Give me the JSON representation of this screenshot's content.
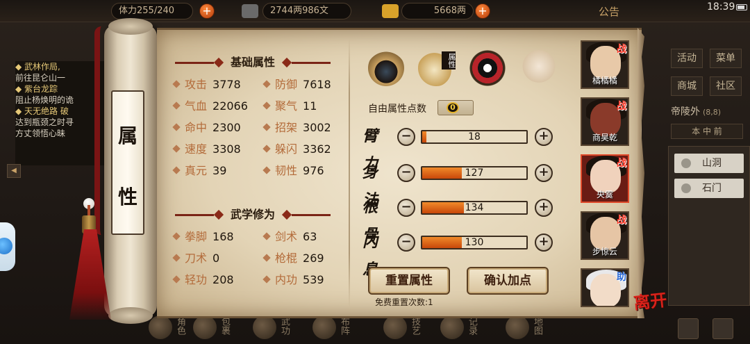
{
  "status": {
    "time": "18:39",
    "notice_label": "公告"
  },
  "resources": {
    "stamina": "体力255/240",
    "money": "2744两986文",
    "gold": "5668两"
  },
  "quests": [
    {
      "title": "◆ 武林作局,",
      "desc": "前往昆仑山一"
    },
    {
      "title": "◆ 紫台龙踪",
      "desc": "阻止杨焕明的诡"
    },
    {
      "title": "◆ 天无绝路 破",
      "desc": "达到瓶颈之时寻"
    },
    {
      "title": "",
      "desc": "方丈领悟心昧"
    }
  ],
  "scroll_title": [
    "属",
    "性"
  ],
  "basic_attrs": {
    "title": "基础属性",
    "items": [
      {
        "label": "攻击",
        "value": "3778"
      },
      {
        "label": "防御",
        "value": "7618"
      },
      {
        "label": "气血",
        "value": "22066"
      },
      {
        "label": "聚气",
        "value": "11"
      },
      {
        "label": "命中",
        "value": "2300"
      },
      {
        "label": "招架",
        "value": "3002"
      },
      {
        "label": "速度",
        "value": "3308"
      },
      {
        "label": "躲闪",
        "value": "3362"
      },
      {
        "label": "真元",
        "value": "39"
      },
      {
        "label": "韧性",
        "value": "976"
      }
    ]
  },
  "martial_attrs": {
    "title": "武学修为",
    "items": [
      {
        "label": "拳脚",
        "value": "168"
      },
      {
        "label": "剑术",
        "value": "63"
      },
      {
        "label": "刀术",
        "value": "0"
      },
      {
        "label": "枪棍",
        "value": "269"
      },
      {
        "label": "轻功",
        "value": "208"
      },
      {
        "label": "内功",
        "value": "539"
      }
    ]
  },
  "category_icons": [
    "hat-icon",
    "attribute-book-icon",
    "bagua-icon",
    "meridian-figure-icon"
  ],
  "category_badge": "属性",
  "free_points": {
    "label": "自由属性点数",
    "value": "0"
  },
  "allocations": [
    {
      "name": "臂力",
      "value": 18,
      "fill": 0.04
    },
    {
      "name": "身法",
      "value": 127,
      "fill": 0.38
    },
    {
      "name": "根骨",
      "value": 134,
      "fill": 0.4
    },
    {
      "name": "内息",
      "value": 130,
      "fill": 0.38
    }
  ],
  "buttons": {
    "reset": "重置属性",
    "confirm": "确认加点"
  },
  "reset_note": "免费重置次数:1",
  "heroes": [
    {
      "name": "橘橘橘",
      "tag": "战",
      "active": false,
      "skin": "#e8c9a8"
    },
    {
      "name": "商昊乾",
      "tag": "战",
      "active": false,
      "skin": "#8a3a2a"
    },
    {
      "name": "央霙",
      "tag": "战",
      "active": true,
      "skin": "#f0d2bc"
    },
    {
      "name": "步惊云",
      "tag": "战",
      "active": false,
      "skin": "#e6c5a5"
    },
    {
      "name": "",
      "tag": "助",
      "active": false,
      "skin": "#f2dcc8"
    }
  ],
  "leave_label": "离开",
  "right_menu": [
    "活动",
    "菜单",
    "商城",
    "社区"
  ],
  "location": {
    "name": "帝陵外",
    "coords": "(8,8)"
  },
  "location_tabs": "本 中 前",
  "map_items": [
    "山洞",
    "石门"
  ],
  "bottom_menu": [
    "角色",
    "包裹",
    "武功",
    "布阵",
    "技艺",
    "记录",
    "地图"
  ],
  "colors": {
    "accent_red": "#7a1414",
    "bar_orange": "#f08a2a",
    "label_brown": "#b36b3a"
  }
}
